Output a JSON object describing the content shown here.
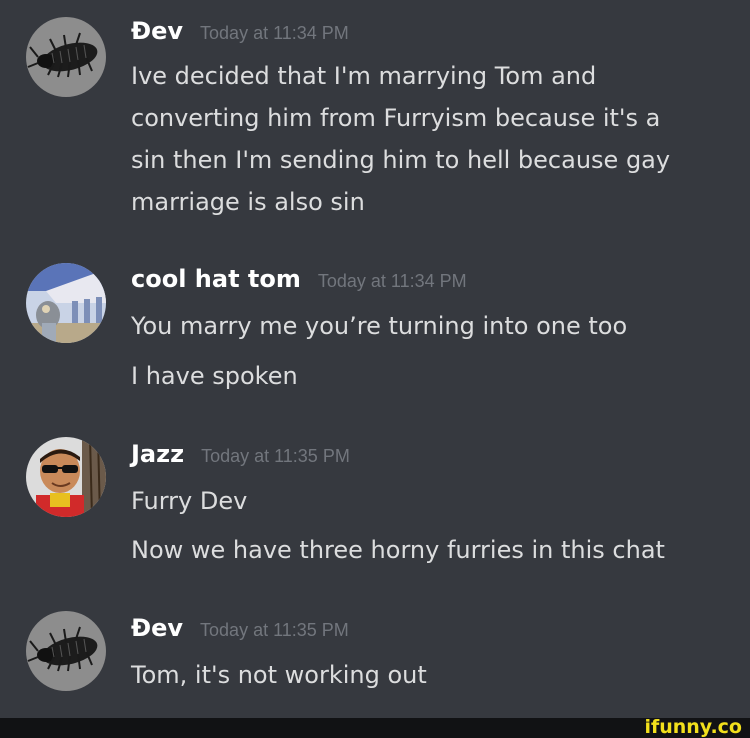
{
  "messages": [
    {
      "username": "Ɖev",
      "timestamp": "Today at 11:34 PM",
      "avatar_icon": "dark-bug-avatar",
      "lines": [
        "Ive decided that I'm marrying Tom and",
        "converting him from Furryism because it's a",
        "sin then I'm sending him to hell because gay",
        "marriage is also sin"
      ]
    },
    {
      "username": "cool hat tom",
      "timestamp": "Today at 11:34 PM",
      "avatar_icon": "cartoon-character-avatar",
      "lines": [
        "You marry me you’re turning into one too",
        "I have spoken"
      ]
    },
    {
      "username": "Jazz",
      "timestamp": "Today at 11:35 PM",
      "avatar_icon": "sunglasses-person-avatar",
      "lines": [
        "Furry Dev",
        "Now we have three horny furries in this chat"
      ]
    },
    {
      "username": "Ɖev",
      "timestamp": "Today at 11:35 PM",
      "avatar_icon": "dark-bug-avatar",
      "lines": [
        "Tom, it's not working out"
      ]
    }
  ],
  "watermark": "ifunny.co",
  "colors": {
    "background": "#36393f",
    "username": "#ffffff",
    "message_text": "#dcddde",
    "timestamp": "#72767d",
    "watermark": "#f2e01c"
  }
}
